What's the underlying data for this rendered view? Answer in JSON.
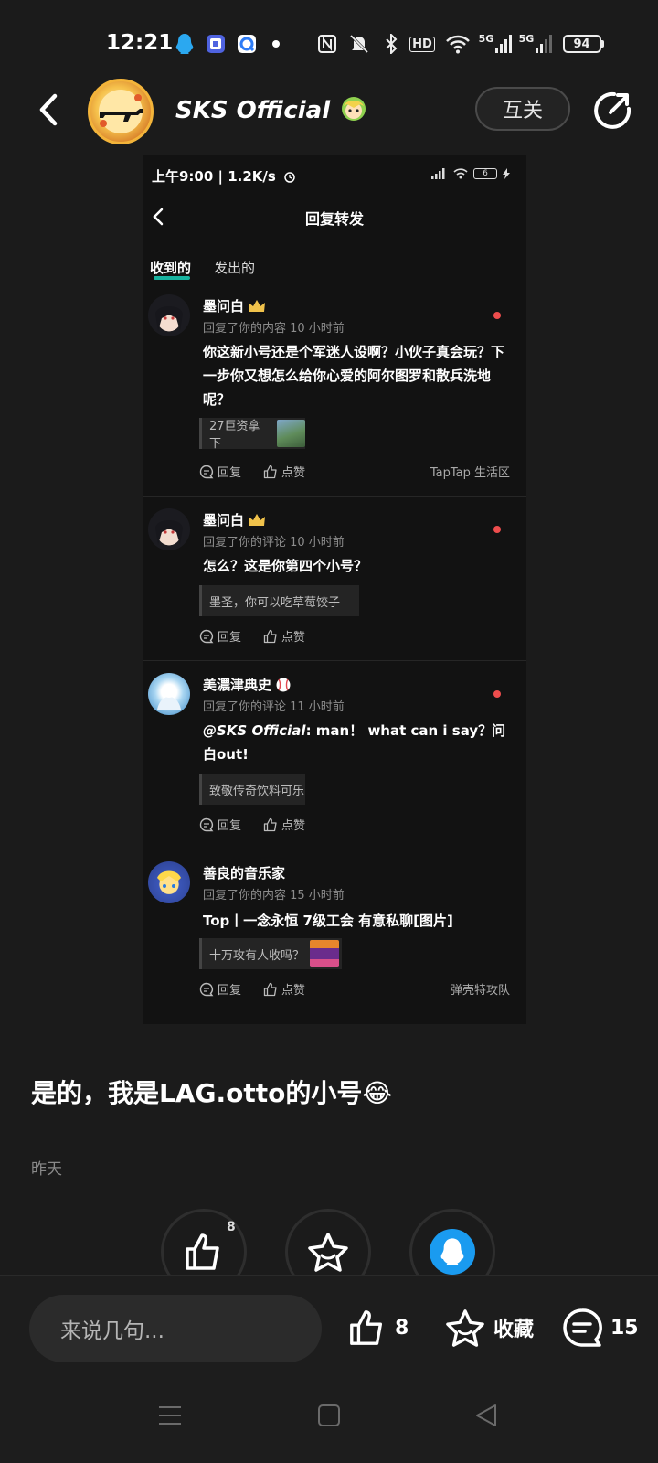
{
  "status_bar": {
    "time": "12:21",
    "hd_badge": "HD",
    "net1": "5G",
    "net2": "5G",
    "battery": "94"
  },
  "header": {
    "username": "SKS Official",
    "mutual_label": "互关",
    "icons": [
      "back-arrow-icon",
      "share-icon"
    ]
  },
  "screenshot": {
    "status_time": "上午9:00 | 1.2K/s",
    "battery": "6",
    "title": "回复转发",
    "tabs": [
      "收到的",
      "发出的"
    ],
    "items": [
      {
        "name": "墨问白",
        "badge": "crown",
        "subtitle": "回复了你的内容 10 小时前",
        "body": "你这新小号还是个军迷人设啊？小伙子真会玩？下一步你又想怎么给你心爱的阿尔图罗和散兵洗地呢？",
        "quote": "27巨资拿下",
        "reply_label": "回复",
        "like_label": "点赞",
        "source": "TapTap 生活区"
      },
      {
        "name": "墨问白",
        "badge": "crown",
        "subtitle": "回复了你的评论 10 小时前",
        "body": "怎么？这是你第四个小号？",
        "quote": "墨圣，你可以吃草莓饺子",
        "reply_label": "回复",
        "like_label": "点赞",
        "source": ""
      },
      {
        "name": "美濃津典史",
        "badge": "baseball",
        "subtitle": "回复了你的评论 11 小时前",
        "body_mention": "@SKS Official",
        "body": ": man！ what can i say？问白out!",
        "quote": "致敬传奇饮料可乐",
        "reply_label": "回复",
        "like_label": "点赞",
        "source": ""
      },
      {
        "name": "善良的音乐家",
        "badge": "",
        "subtitle": "回复了你的内容 15 小时前",
        "body": "Top丨一念永恒 7级工会 有意私聊[图片]",
        "quote": "十万攻有人收吗？",
        "reply_label": "回复",
        "like_label": "点赞",
        "source": "弹壳特攻队"
      }
    ]
  },
  "post": {
    "text": "是的，我是LAG.otto的小号😂",
    "time": "昨天",
    "like_count": "8"
  },
  "bottom_bar": {
    "input_placeholder": "来说几句...",
    "like_count": "8",
    "favorite_label": "收藏",
    "comment_count": "15"
  },
  "colors": {
    "background": "#1b1b1b",
    "accent_teal": "#18b3a0",
    "unread_dot": "#ee4d4d",
    "qq_blue": "#1a9bf0"
  }
}
